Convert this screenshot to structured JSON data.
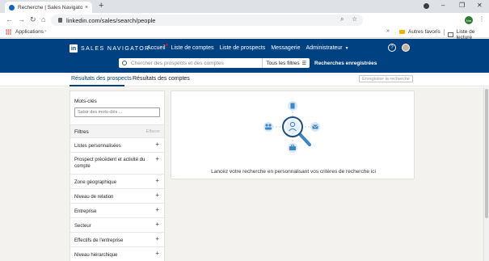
{
  "browser": {
    "tab_title": "Recherche | Sales Navigator",
    "tab_close": "×",
    "new_tab": "+",
    "url": "linkedin.com/sales/search/people",
    "profile_initials": "Nm",
    "window_minimize": "–",
    "window_restore": "❐",
    "window_close": "✕",
    "bookmarks": {
      "apps_label": "Applications",
      "more": "»",
      "other_bookmarks": "Autres favoris",
      "reading_list": "Liste de lecture"
    }
  },
  "header": {
    "logo_in": "in",
    "brand": "SALES NAVIGATOR",
    "nav": [
      {
        "label": "Accueil"
      },
      {
        "label": "Liste de comptes"
      },
      {
        "label": "Liste de prospects"
      },
      {
        "label": "Messagerie"
      },
      {
        "label": "Administrateur"
      }
    ],
    "help": "?",
    "search_placeholder": "Chercher des prospects et des comptes",
    "all_filters_label": "Tous les filtres",
    "saved_searches_label": "Recherches enregistrées"
  },
  "tabs": {
    "leads": "Résultats des prospects",
    "accounts": "Résultats des comptes",
    "save_search": "Enregistrer la recherche"
  },
  "sidebar": {
    "keywords_label": "Mots-clés",
    "keywords_placeholder": "Saisir des mots-clés ...",
    "filters_title": "Filtres",
    "filters_clear": "Effacer",
    "filters": [
      {
        "label": "Listes personnalisées"
      },
      {
        "label": "Prospect précédent et activité du compte"
      },
      {
        "label": "Zone géographique"
      },
      {
        "label": "Niveau de relation"
      },
      {
        "label": "Entreprise"
      },
      {
        "label": "Secteur"
      },
      {
        "label": "Effectifs de l'entreprise"
      },
      {
        "label": "Niveau hiérarchique"
      }
    ]
  },
  "main": {
    "empty_message": "Lancez votre recherche en personnalisant vos critères de recherche ici"
  },
  "colors": {
    "header_bg": "#004182",
    "accent": "#0a66c2",
    "illustration_blue": "#3d86c6"
  }
}
